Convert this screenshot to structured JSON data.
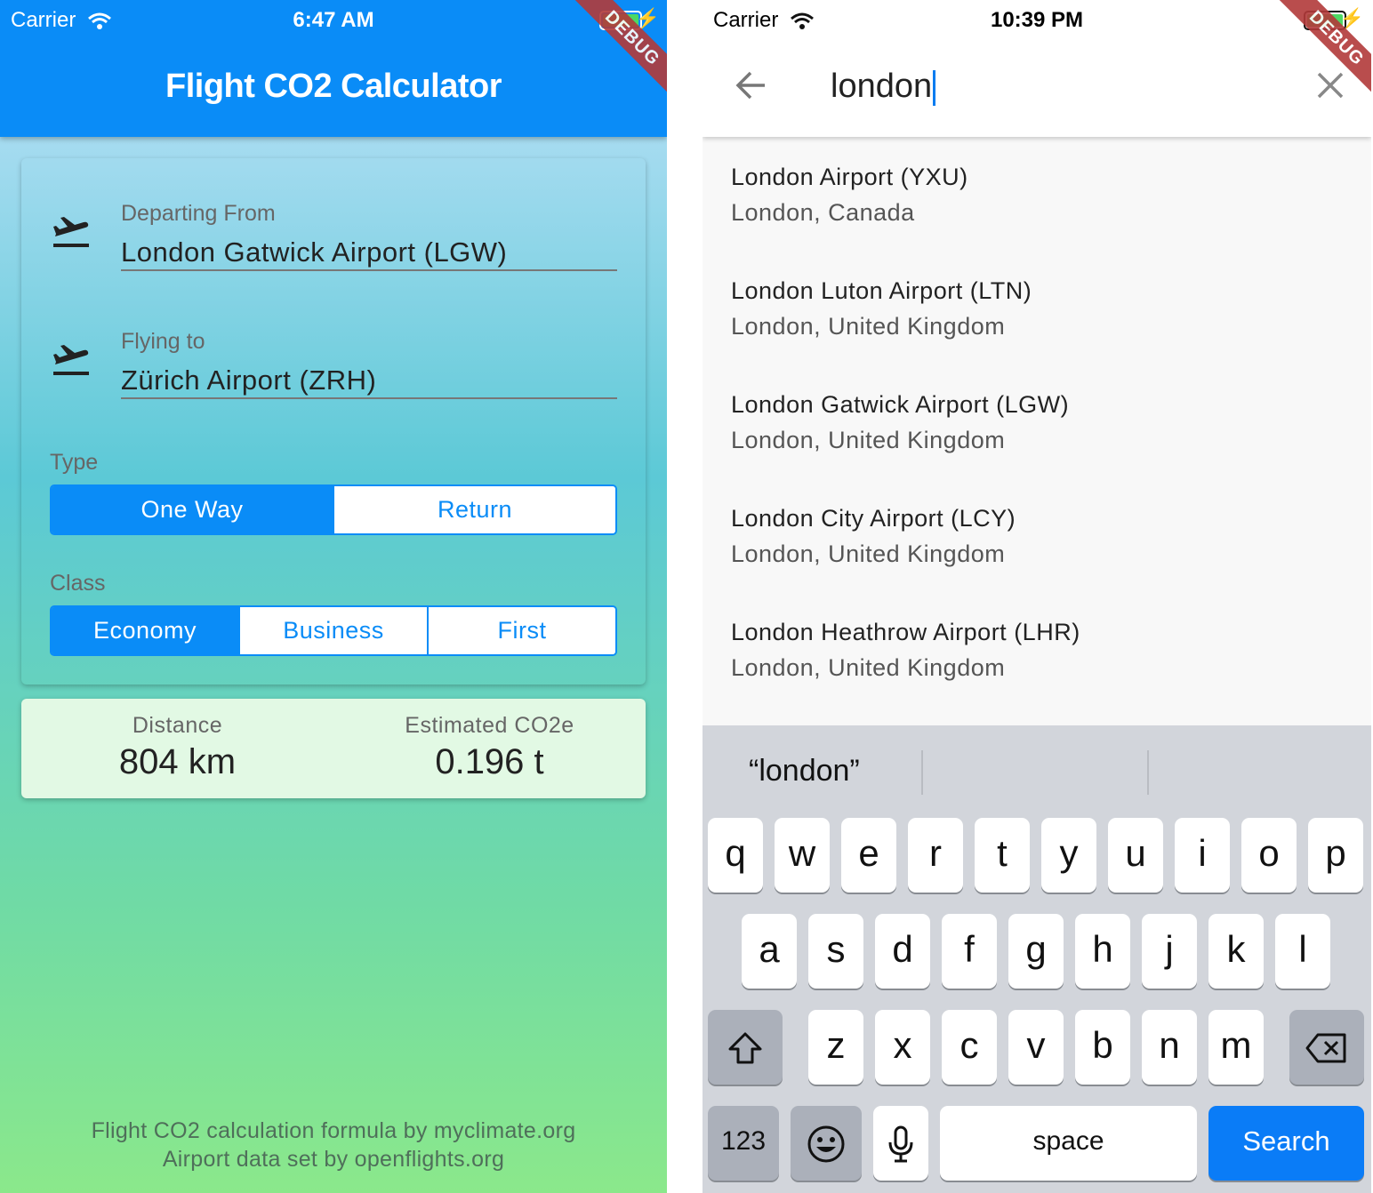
{
  "left": {
    "status": {
      "carrier": "Carrier",
      "time": "6:47 AM",
      "debug": "DEBUG"
    },
    "title": "Flight CO2 Calculator",
    "departing": {
      "label": "Departing From",
      "value": "London Gatwick Airport (LGW)",
      "icon": "flight-takeoff-icon"
    },
    "arriving": {
      "label": "Flying to",
      "value": "Zürich Airport (ZRH)",
      "icon": "flight-takeoff-icon"
    },
    "type": {
      "label": "Type",
      "options": [
        "One Way",
        "Return"
      ],
      "selected": "One Way"
    },
    "class": {
      "label": "Class",
      "options": [
        "Economy",
        "Business",
        "First"
      ],
      "selected": "Economy"
    },
    "distance": {
      "label": "Distance",
      "value": "804 km"
    },
    "co2": {
      "label": "Estimated CO2e",
      "value": "0.196 t"
    },
    "footer": [
      "Flight CO2 calculation formula by myclimate.org",
      "Airport data set by openflights.org"
    ],
    "colors": {
      "primary": "#0a8cf7"
    }
  },
  "right": {
    "status": {
      "carrier": "Carrier",
      "time": "10:39 PM",
      "debug": "DEBUG"
    },
    "search": {
      "query": "london",
      "back_icon": "arrow-left-icon",
      "clear_icon": "close-icon"
    },
    "results": [
      {
        "title": "London Airport (YXU)",
        "subtitle": "London, Canada"
      },
      {
        "title": "London Luton Airport (LTN)",
        "subtitle": "London, United Kingdom"
      },
      {
        "title": "London Gatwick Airport (LGW)",
        "subtitle": "London, United Kingdom"
      },
      {
        "title": "London City Airport (LCY)",
        "subtitle": "London, United Kingdom"
      },
      {
        "title": "London Heathrow Airport (LHR)",
        "subtitle": "London, United Kingdom"
      }
    ],
    "keyboard": {
      "suggestion": "“london”",
      "row1": [
        "q",
        "w",
        "e",
        "r",
        "t",
        "y",
        "u",
        "i",
        "o",
        "p"
      ],
      "row2": [
        "a",
        "s",
        "d",
        "f",
        "g",
        "h",
        "j",
        "k",
        "l"
      ],
      "row3": [
        "z",
        "x",
        "c",
        "v",
        "b",
        "n",
        "m"
      ],
      "numbers": "123",
      "space": "space",
      "action": "Search",
      "icons": [
        "shift-icon",
        "backspace-icon",
        "emoji-icon",
        "microphone-icon"
      ]
    }
  }
}
